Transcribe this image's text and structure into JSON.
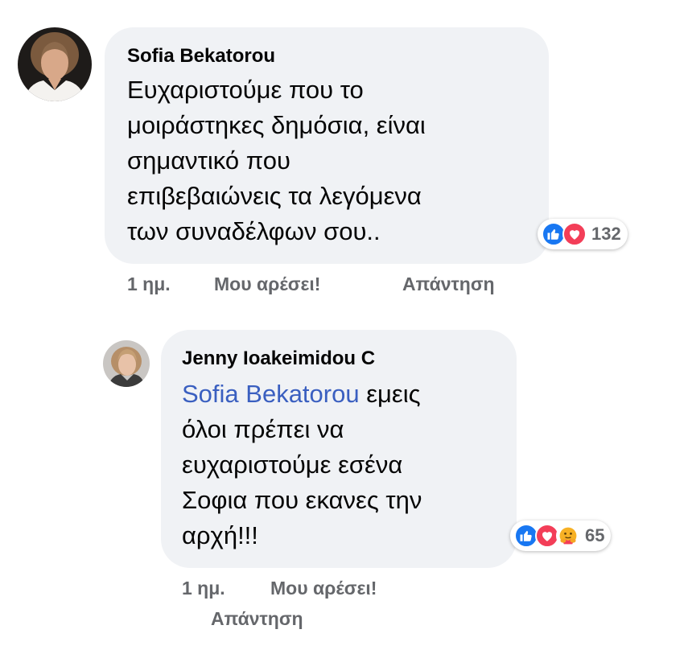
{
  "comments": [
    {
      "author": "Sofia Bekatorou",
      "mention": "",
      "lines": [
        "Ευχαριστούμε που το",
        "μοιράστηκες δημόσια, είναι",
        "σημαντικό που",
        "επιβεβαιώνεις τα λεγόμενα",
        "των  συναδέλφων σου.."
      ],
      "reactions": [
        "like-icon",
        "love-icon"
      ],
      "reaction_count": "132",
      "time": "1 ημ.",
      "like_label": "Μου αρέσει!",
      "reply_label": "Απάντηση"
    },
    {
      "author": "Jenny Ioakeimidou C",
      "mention": "Sofia Bekatorou",
      "lines": [
        " εμεις",
        "όλοι πρέπει να",
        "ευχαριστούμε εσένα",
        "Σοφια που εκανες την",
        "αρχή!!!"
      ],
      "reactions": [
        "like-icon",
        "love-icon",
        "care-icon"
      ],
      "reaction_count": "65",
      "time": "1 ημ.",
      "like_label": "Μου αρέσει!",
      "reply_label": "Απάντηση"
    }
  ],
  "colors": {
    "bubble": "#f0f2f5",
    "mention": "#3a5fc0",
    "meta": "#65676b",
    "like": "#1877f2",
    "love": "#f33e58"
  }
}
